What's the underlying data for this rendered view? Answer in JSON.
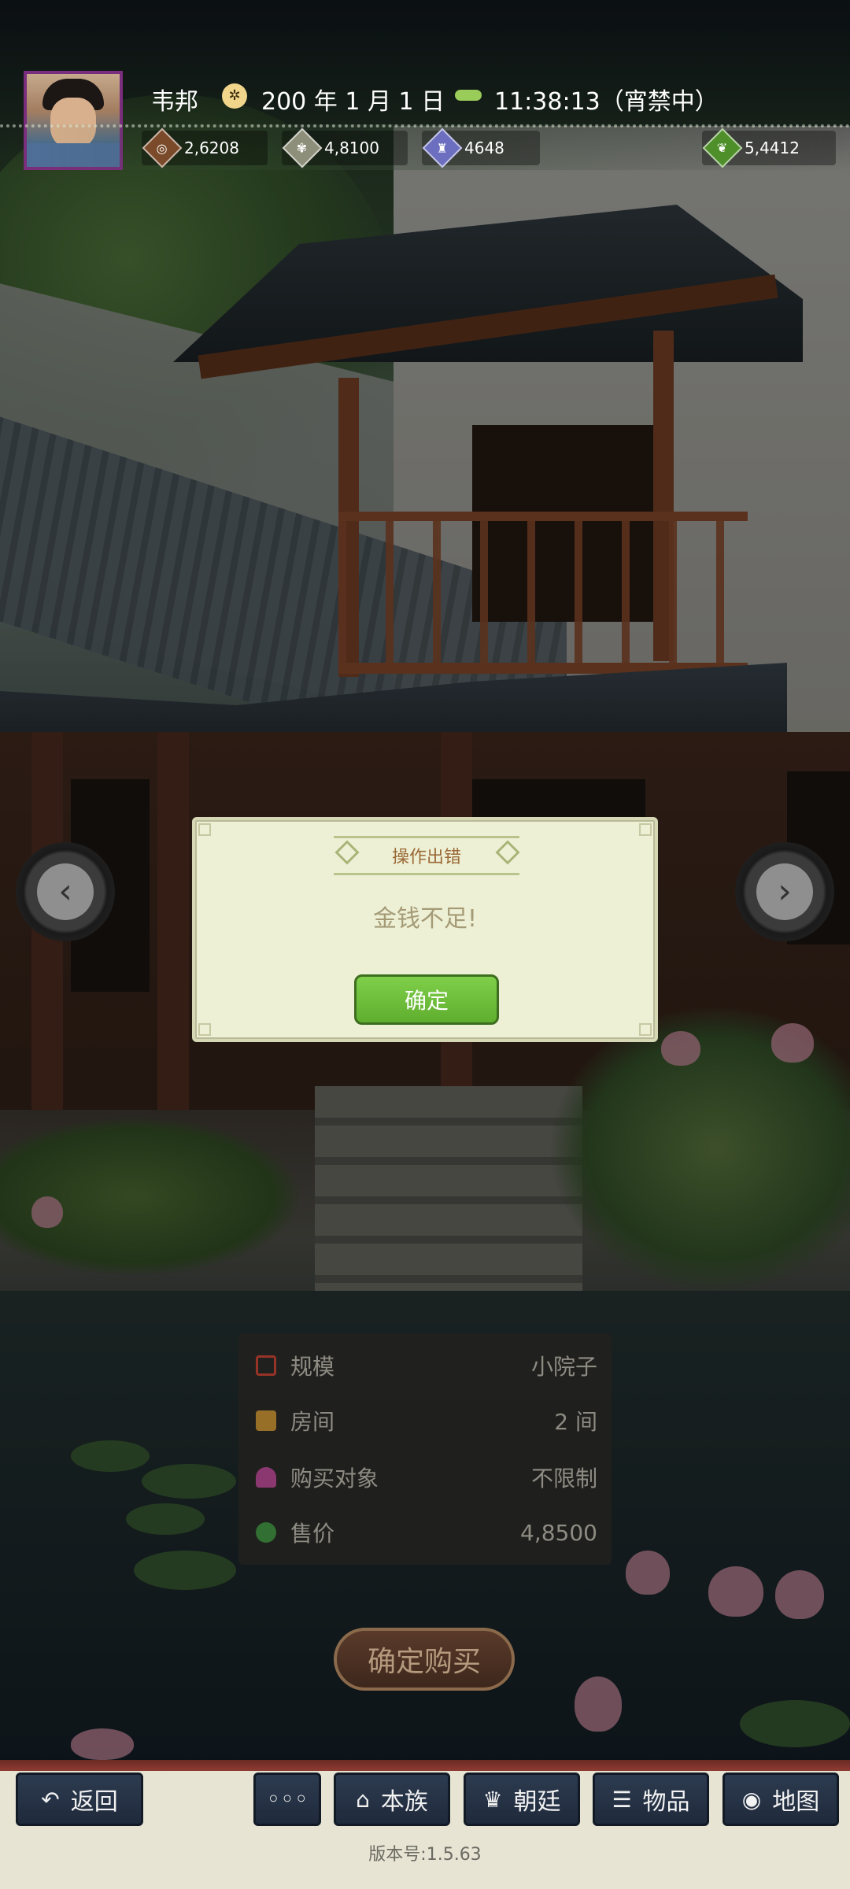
{
  "header": {
    "player_name": "韦邦",
    "date": "200 年 1 月 1 日",
    "time": "11:38:13（宵禁中）"
  },
  "resources": [
    {
      "icon": "coins-icon",
      "value": "2,6208",
      "color": "#7a4a2a"
    },
    {
      "icon": "grain-icon",
      "value": "4,8100",
      "color": "#8e8f7a"
    },
    {
      "icon": "soldier-icon",
      "value": "4648",
      "color": "#6c6fbf"
    },
    {
      "icon": "money-bag-icon",
      "value": "5,4412",
      "color": "#4f8f2a"
    }
  ],
  "nav": {
    "prev": "‹",
    "next": "›"
  },
  "property": {
    "rows": [
      {
        "icon": "scale-icon",
        "label": "规模",
        "value": "小院子",
        "color": "#c0392b"
      },
      {
        "icon": "room-icon",
        "label": "房间",
        "value": "2 间",
        "color": "#c08a2b"
      },
      {
        "icon": "buyer-icon",
        "label": "购买对象",
        "value": "不限制",
        "color": "#b0408c"
      },
      {
        "icon": "price-icon",
        "label": "售价",
        "value": "4,8500",
        "color": "#3a8a3a"
      }
    ],
    "buy_label": "确定购买"
  },
  "dialog": {
    "title": "操作出错",
    "message": "金钱不足!",
    "ok_label": "确定"
  },
  "bottom_nav": [
    {
      "icon": "back-icon",
      "label": "返回"
    },
    {
      "icon": "more-icon",
      "label": "◦◦◦"
    },
    {
      "icon": "clan-icon",
      "label": "本族"
    },
    {
      "icon": "court-icon",
      "label": "朝廷"
    },
    {
      "icon": "items-icon",
      "label": "物品"
    },
    {
      "icon": "map-icon",
      "label": "地图"
    }
  ],
  "version": "版本号:1.5.63",
  "colors": {
    "dialog_bg": "#eef0d5",
    "ok_button": "#6cbf3a",
    "nav_button": "#26334a",
    "avatar_border": "#7b2d7d"
  }
}
